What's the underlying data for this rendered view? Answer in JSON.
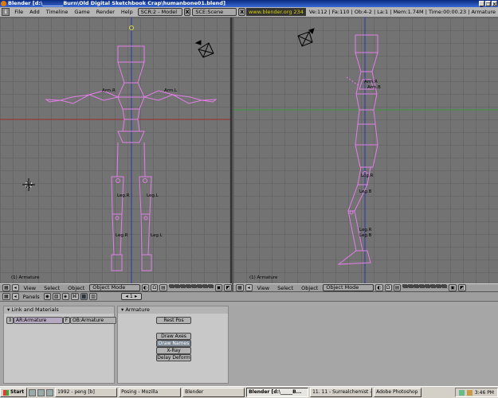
{
  "titlebar": {
    "title": "Blender [d:\\________Burn\\Old Digital Sketchbook Crap\\humanbone01.blend]",
    "buttons": [
      "_",
      "□",
      "×"
    ]
  },
  "menubar": {
    "info_icon": "i",
    "menus": [
      "File",
      "Add",
      "Timeline",
      "Game",
      "Render",
      "Help"
    ],
    "screen_field": "SCR:2 - Model",
    "scene_field": "SCE:Scene",
    "close_x": "X",
    "website": "www.blender.org 234",
    "stats": "Ve:112 | Fa:110 | Ob:4-2 | La:1 | Mem:1.74M | Time:00:00.23 | Armature"
  },
  "viewports": {
    "left_label": "(1) Armature",
    "right_label": "(1) Armature",
    "front_bones": [
      "Arm.R",
      "Arm.L",
      "Leg.R",
      "Leg.L",
      "Leg.R",
      "Leg.L"
    ],
    "side_bones": [
      "Arm.R",
      "Arm.B",
      "Leg.R",
      "Leg.B",
      "Leg.R",
      "Leg.B"
    ]
  },
  "headers": {
    "menus": [
      "View",
      "Select",
      "Object"
    ],
    "mode": "Object Mode"
  },
  "panels": {
    "header_label": "Panels",
    "frame": "1",
    "link_title": "Link and Materials",
    "ar_field": "AR:Armature",
    "f_label": "F",
    "ob_field": "OB:Armature",
    "armature_title": "Armature",
    "rest_pos": "Rest Pos",
    "draw_axes": "Draw Axes",
    "draw_names": "Draw Names",
    "xray": "X-Ray",
    "delay_deform": "Delay Deform"
  },
  "taskbar": {
    "start": "Start",
    "tasks": [
      "1992 - peng [b]",
      "Posing - Mozilla",
      "Blender",
      "Blender [d:\\_____B...",
      "11. 11 - Surrealchemist - ...",
      "Adobe Photoshop"
    ],
    "active_task_index": 3,
    "clock": "3:46 PM"
  },
  "colors": {
    "bone": "#e17fe7",
    "grid": "#676767",
    "viewport_bg": "#737373",
    "website_text": "#d9d200"
  }
}
